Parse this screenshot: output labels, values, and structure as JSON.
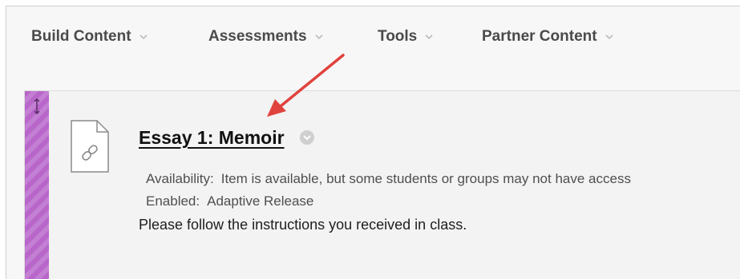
{
  "toolbar": {
    "menus": [
      {
        "label": "Build Content",
        "icon": "chevron-down-icon"
      },
      {
        "label": "Assessments",
        "icon": "chevron-down-icon"
      },
      {
        "label": "Tools",
        "icon": "chevron-down-icon"
      },
      {
        "label": "Partner Content",
        "icon": "chevron-down-icon"
      }
    ]
  },
  "item": {
    "title": "Essay 1: Memoir",
    "icon": "link-document-icon",
    "availability_label": "Availability:",
    "availability_value": "Item is available, but some students or groups may not have access",
    "enabled_label": "Enabled:",
    "enabled_value": "Adaptive Release",
    "description": "Please follow the instructions you received in class."
  },
  "colors": {
    "handle": "#b866c9",
    "annotation_arrow": "#e0423d"
  }
}
